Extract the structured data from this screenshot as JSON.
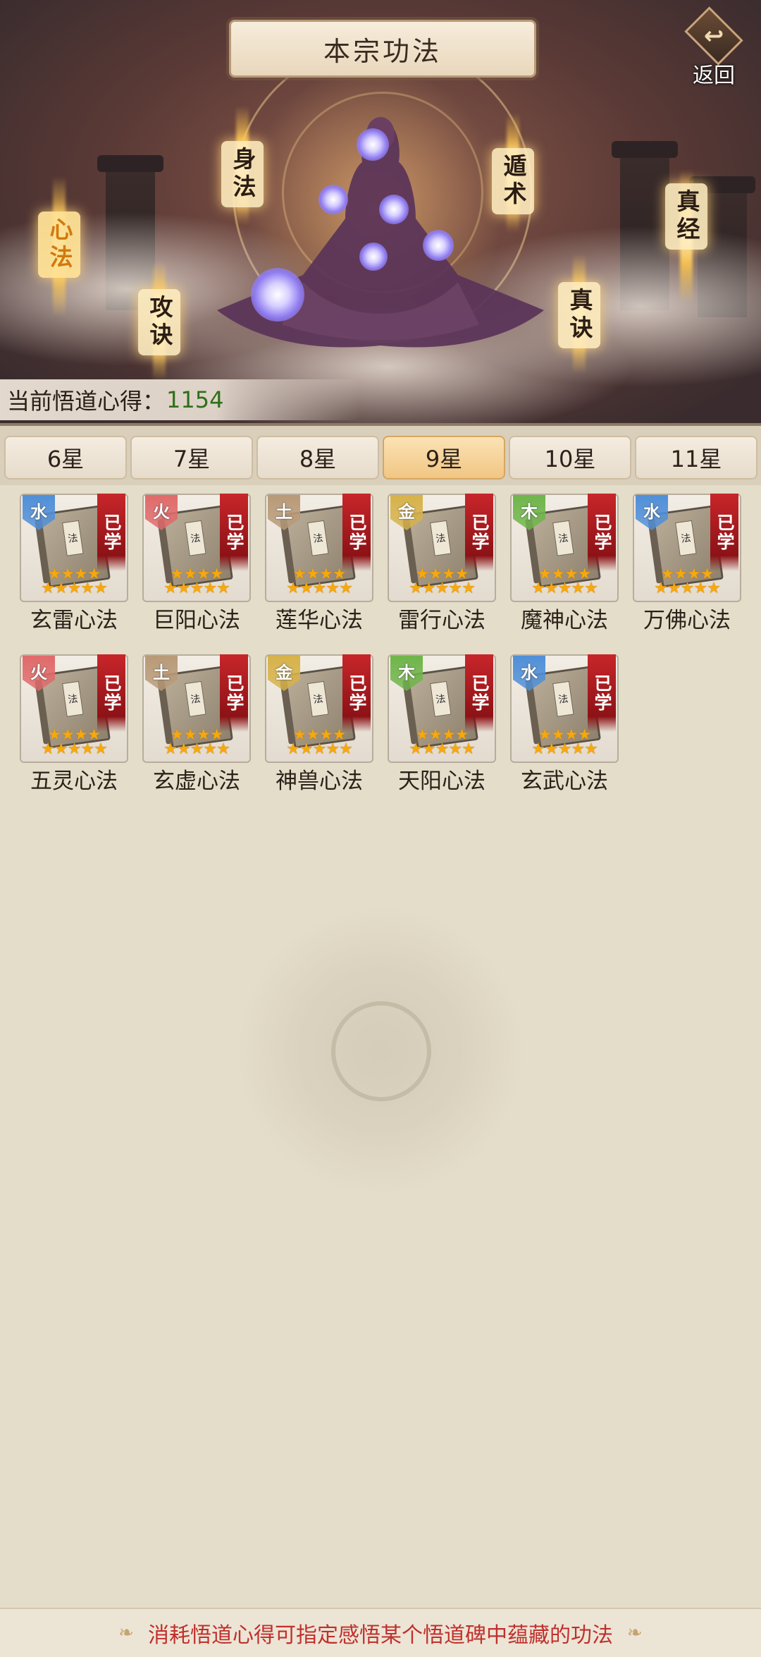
{
  "header": {
    "title": "本宗功法",
    "back_label": "返回",
    "back_icon_glyph": "↩"
  },
  "hero": {
    "skills": [
      {
        "label": "身法",
        "active": false
      },
      {
        "label": "心法",
        "active": true
      },
      {
        "label": "攻诀",
        "active": false
      },
      {
        "label": "遁术",
        "active": false
      },
      {
        "label": "真诀",
        "active": false
      },
      {
        "label": "真经",
        "active": false
      }
    ]
  },
  "insight": {
    "label": "当前悟道心得：",
    "value": "1154"
  },
  "tabs": [
    {
      "label": "6星",
      "active": false
    },
    {
      "label": "7星",
      "active": false
    },
    {
      "label": "8星",
      "active": false
    },
    {
      "label": "9星",
      "active": true
    },
    {
      "label": "10星",
      "active": false
    },
    {
      "label": "11星",
      "active": false
    }
  ],
  "learned_label": "已学",
  "items": [
    {
      "name": "玄雷心法",
      "element": "水",
      "stars": 9
    },
    {
      "name": "巨阳心法",
      "element": "火",
      "stars": 9
    },
    {
      "name": "莲华心法",
      "element": "土",
      "stars": 9
    },
    {
      "name": "雷行心法",
      "element": "金",
      "stars": 9
    },
    {
      "name": "魔神心法",
      "element": "木",
      "stars": 9
    },
    {
      "name": "万佛心法",
      "element": "水",
      "stars": 9
    },
    {
      "name": "五灵心法",
      "element": "火",
      "stars": 9
    },
    {
      "name": "玄虚心法",
      "element": "土",
      "stars": 9
    },
    {
      "name": "神兽心法",
      "element": "金",
      "stars": 9
    },
    {
      "name": "天阳心法",
      "element": "木",
      "stars": 9
    },
    {
      "name": "玄武心法",
      "element": "水",
      "stars": 9
    }
  ],
  "element_colors": {
    "水": "#4f8fd8",
    "火": "#e06a6a",
    "土": "#b89a78",
    "金": "#d7b24a",
    "木": "#6fb54a"
  },
  "footer": {
    "hint": "消耗悟道心得可指定感悟某个悟道碑中蕴藏的功法",
    "deco_left": "❧",
    "deco_right": "❧"
  },
  "colors": {
    "accent_tab": "#f1c684",
    "learned_banner": "#c8262a",
    "insight_value": "#2f6f1a",
    "hint_text": "#c0302c"
  }
}
